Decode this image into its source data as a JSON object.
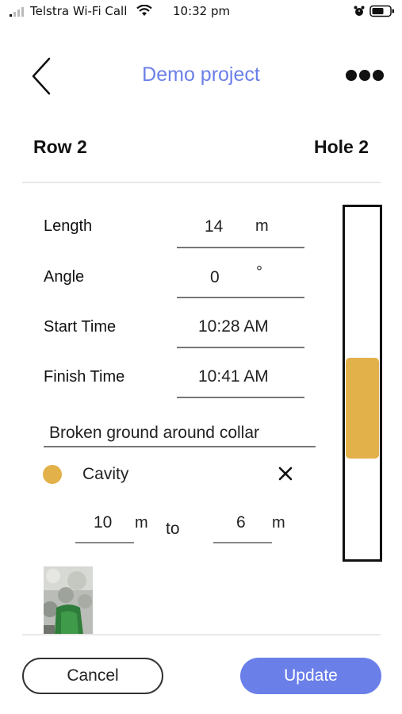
{
  "status_bar": {
    "carrier": "Telstra Wi-Fi Call",
    "time": "10:32 pm",
    "icons": [
      "signal-icon",
      "wifi-icon",
      "alarm-icon",
      "battery-icon"
    ]
  },
  "header": {
    "title": "Demo project",
    "back_icon": "chevron-left-icon",
    "more_icon": "more-dots-icon",
    "title_color": "#6a7fe8"
  },
  "location": {
    "row": "Row 2",
    "hole": "Hole 2"
  },
  "fields": {
    "length": {
      "label": "Length",
      "value": "14",
      "unit": "m"
    },
    "angle": {
      "label": "Angle",
      "value": "0",
      "unit": "°"
    },
    "start_time": {
      "label": "Start Time",
      "value": "10:28 AM"
    },
    "finish_time": {
      "label": "Finish Time",
      "value": "10:41 AM"
    }
  },
  "note": "Broken ground around collar",
  "feature": {
    "name": "Cavity",
    "color": "#e3b14a",
    "from_value": "10",
    "from_unit": "m",
    "to_label": "to",
    "to_value": "6",
    "to_unit": "m",
    "close_icon": "close-icon"
  },
  "hole_bar": {
    "total_length_m": 14,
    "segment_from_m": 6,
    "segment_to_m": 10,
    "segment_color": "#e3b14a"
  },
  "actions": {
    "cancel_label": "Cancel",
    "update_label": "Update",
    "update_color": "#6a7fe8"
  }
}
